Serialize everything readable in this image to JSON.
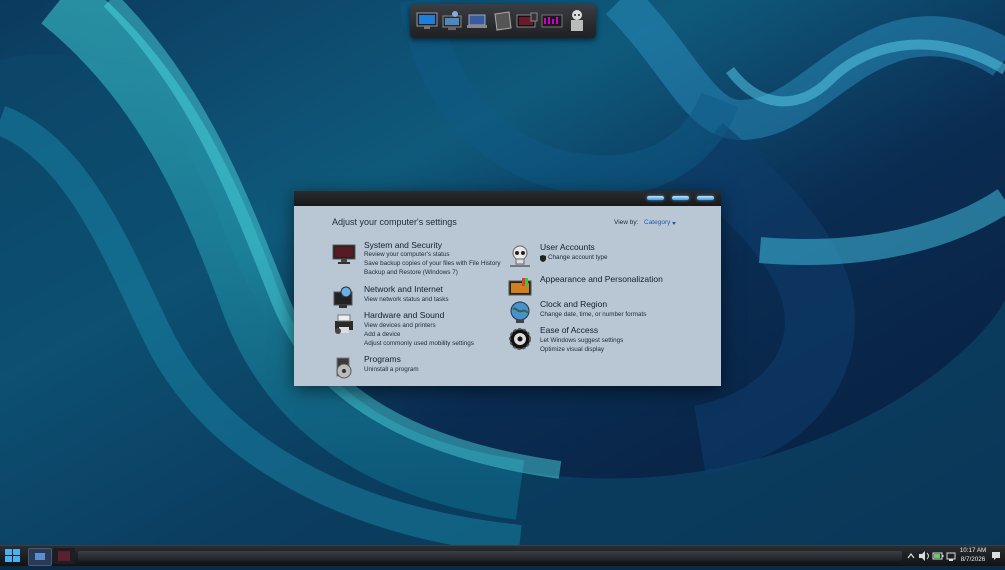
{
  "dock": {
    "items": [
      "monitor-icon",
      "computer-icon",
      "laptop-icon",
      "drive-icon",
      "devices-icon",
      "equalizer-icon",
      "settings-robot-icon"
    ]
  },
  "window": {
    "heading": "Adjust your computer's settings",
    "view_by_label": "View by:",
    "view_by_value": "Category",
    "left_categories": [
      {
        "title": "System and Security",
        "links": [
          "Review your computer's status",
          "Save backup copies of your files with File History",
          "Backup and Restore (Windows 7)"
        ]
      },
      {
        "title": "Network and Internet",
        "links": [
          "View network status and tasks"
        ]
      },
      {
        "title": "Hardware and Sound",
        "links": [
          "View devices and printers",
          "Add a device",
          "Adjust commonly used mobility settings"
        ]
      },
      {
        "title": "Programs",
        "links": [
          "Uninstall a program"
        ]
      }
    ],
    "right_categories": [
      {
        "title": "User Accounts",
        "links": [
          "Change account type"
        ]
      },
      {
        "title": "Appearance and Personalization",
        "links": []
      },
      {
        "title": "Clock and Region",
        "links": [
          "Change date, time, or number formats"
        ]
      },
      {
        "title": "Ease of Access",
        "links": [
          "Let Windows suggest settings",
          "Optimize visual display"
        ]
      }
    ]
  },
  "taskbar": {
    "time": "10:17 AM",
    "date": "8/7/2026"
  },
  "colors": {
    "window_bg": "#b9c7d5",
    "accent": "#3ea0e8",
    "taskbar": "#1a1c1f"
  }
}
